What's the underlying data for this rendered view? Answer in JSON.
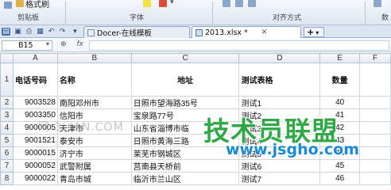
{
  "ribbon": {
    "format_painter": "格式刷",
    "group_clipboard": "剪贴板",
    "group_font": "字体",
    "group_alignment": "对齐方式",
    "group_number": "数"
  },
  "tabs": {
    "docer_label": "Docer-在线模板",
    "file_label": "2013.xlsx *",
    "new_tab": "+"
  },
  "formula_bar": {
    "name_box": "B15",
    "fx": "fx",
    "value": ""
  },
  "columns": [
    "A",
    "B",
    "C",
    "D",
    "E",
    "F"
  ],
  "headers": {
    "phone": "电话号码",
    "name": "名称",
    "address": "地址",
    "test_table": "测试表格",
    "quantity": "数量"
  },
  "rows": [
    {
      "num": "2",
      "phone": "9003528",
      "name": "南阳邓州市",
      "address": "日照市望海路35号",
      "test": "测试1",
      "qty": "40"
    },
    {
      "num": "3",
      "phone": "9003350",
      "name": "信阳市",
      "address": "宝泉路77号",
      "test": "测试2",
      "qty": "41"
    },
    {
      "num": "4",
      "phone": "9000005",
      "name": "天津市",
      "address": "山东省淄博市临",
      "test": "测试3",
      "qty": "42"
    },
    {
      "num": "5",
      "phone": "9001521",
      "name": "泰安市",
      "address": "日照市黄海三路",
      "test": "测试4",
      "qty": "43"
    },
    {
      "num": "6",
      "phone": "9000015",
      "name": "济宁市",
      "address": "莱芜市钢城区",
      "test": "测试5",
      "qty": "44"
    },
    {
      "num": "7",
      "phone": "9000052",
      "name": "武警附属",
      "address": "莒南县天桥前",
      "test": "测试6",
      "qty": "45"
    },
    {
      "num": "8",
      "phone": "9000022",
      "name": "青岛市城",
      "address": "临沂市兰山区",
      "test": "测试7",
      "qty": "46"
    }
  ],
  "watermarks": {
    "left": "网 3LIAN.COM",
    "logo": "技术员联盟",
    "url": "www.jsgho.com"
  }
}
